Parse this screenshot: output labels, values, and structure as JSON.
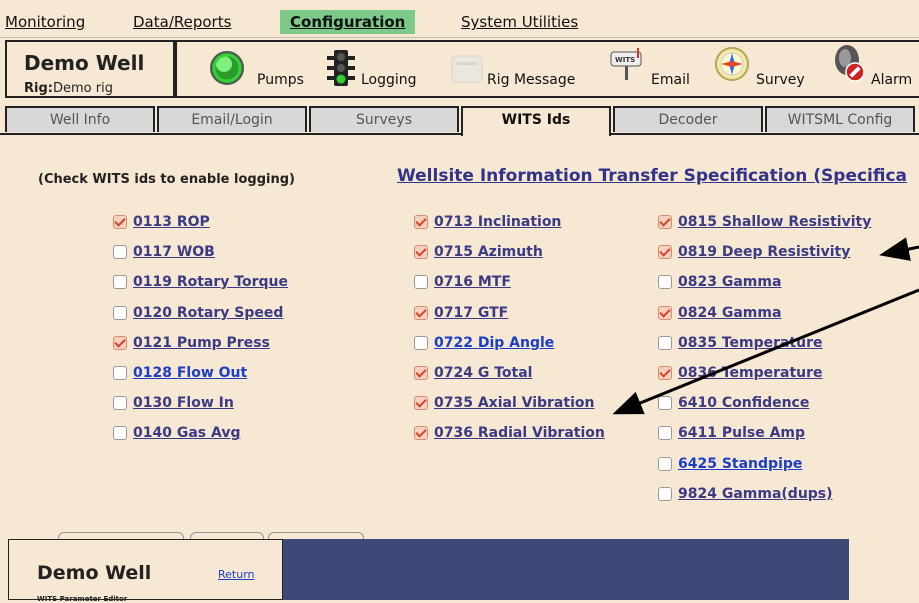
{
  "menu": [
    {
      "label": "Monitoring"
    },
    {
      "label": "Data/Reports"
    },
    {
      "label": "Configuration"
    },
    {
      "label": "System Utilities"
    }
  ],
  "well": {
    "name": "Demo Well",
    "rig_label": "Rig:",
    "rig_value": "Demo rig"
  },
  "toolbar": {
    "pumps": "Pumps",
    "logging": "Logging",
    "rig_message": "Rig Message",
    "email": "Email",
    "survey": "Survey",
    "alarm": "Alarm",
    "email_icon_text": "WITS"
  },
  "tabs": [
    "Well Info",
    "Email/Login",
    "Surveys",
    "WITS Ids",
    "Decoder",
    "WITSML Config"
  ],
  "content": {
    "hint": "(Check WITS ids to enable logging)",
    "spec_link": "Wellsite Information Transfer Specification (Specifica"
  },
  "wits_columns": [
    [
      {
        "label": "0113 ROP",
        "checked": true
      },
      {
        "label": "0117 WOB",
        "checked": false
      },
      {
        "label": "0119 Rotary Torque",
        "checked": false
      },
      {
        "label": "0120 Rotary Speed",
        "checked": false
      },
      {
        "label": "0121 Pump Press",
        "checked": true
      },
      {
        "label": "0128 Flow Out",
        "checked": false,
        "blue": true
      },
      {
        "label": "0130 Flow In",
        "checked": false
      },
      {
        "label": "0140 Gas Avg",
        "checked": false
      }
    ],
    [
      {
        "label": "0713 Inclination",
        "checked": true
      },
      {
        "label": "0715 Azimuth",
        "checked": true
      },
      {
        "label": "0716 MTF",
        "checked": false
      },
      {
        "label": "0717 GTF",
        "checked": true
      },
      {
        "label": "0722 Dip Angle",
        "checked": false,
        "blue": true
      },
      {
        "label": "0724 G Total",
        "checked": true
      },
      {
        "label": "0735 Axial Vibration",
        "checked": true
      },
      {
        "label": "0736 Radial Vibration",
        "checked": true
      }
    ],
    [
      {
        "label": "0815 Shallow Resistivity",
        "checked": true
      },
      {
        "label": "0819 Deep Resistivity",
        "checked": true
      },
      {
        "label": "0823 Gamma",
        "checked": false
      },
      {
        "label": "0824 Gamma",
        "checked": true
      },
      {
        "label": "0835 Temperature",
        "checked": false
      },
      {
        "label": "0836 Temperature",
        "checked": true
      },
      {
        "label": "6410 Confidence",
        "checked": false
      },
      {
        "label": "6411 Pulse Amp",
        "checked": false
      },
      {
        "label": "6425 Standpipe",
        "checked": false,
        "blue": true
      },
      {
        "label": "9824 Gamma(dups)",
        "checked": false
      }
    ]
  ],
  "overlay_window": {
    "title": "Demo Well",
    "return_link": "Return",
    "subtitle": "WITS Parameter Editor"
  }
}
